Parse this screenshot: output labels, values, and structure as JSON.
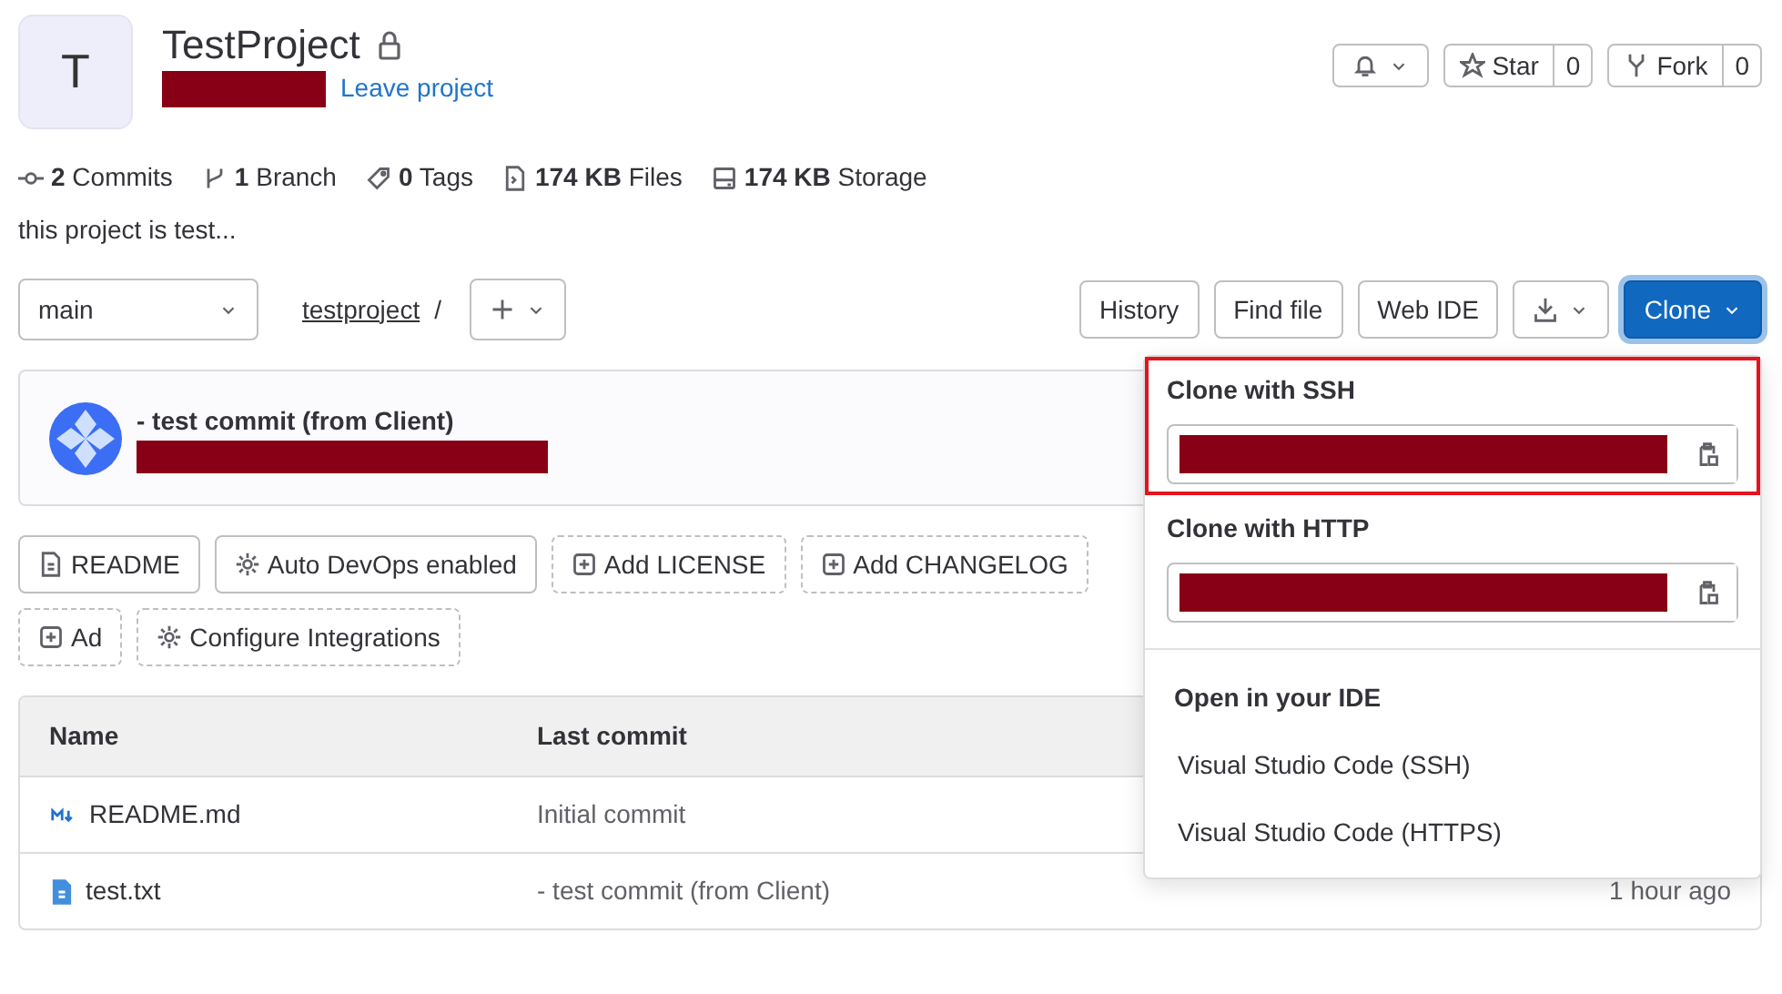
{
  "project": {
    "avatar_letter": "T",
    "name": "TestProject",
    "private": true,
    "leave_link": "Leave project"
  },
  "actions": {
    "star": {
      "label": "Star",
      "count": "0"
    },
    "fork": {
      "label": "Fork",
      "count": "0"
    }
  },
  "stats": [
    {
      "kind": "commits",
      "value": "2",
      "label": "Commits"
    },
    {
      "kind": "branch",
      "value": "1",
      "label": "Branch"
    },
    {
      "kind": "tags",
      "value": "0",
      "label": "Tags"
    },
    {
      "kind": "files",
      "value": "174 KB",
      "label": "Files"
    },
    {
      "kind": "storage",
      "value": "174 KB",
      "label": "Storage"
    }
  ],
  "description": "this project is test...",
  "branch": "main",
  "path": "testproject",
  "path_separator": "/",
  "toolbar_buttons": [
    "History",
    "Find file",
    "Web IDE"
  ],
  "clone_button": "Clone",
  "last_commit": {
    "title": "- test commit (from Client)"
  },
  "quick_buttons": [
    {
      "kind": "document",
      "label": "README"
    },
    {
      "kind": "setting",
      "label": "Auto DevOps enabled"
    },
    {
      "kind": "add",
      "label": "Add LICENSE"
    },
    {
      "kind": "add",
      "label": "Add CHANGELOG"
    },
    {
      "kind": "add",
      "label": "Ad"
    },
    {
      "kind": "setup",
      "label": "Configure Integrations"
    }
  ],
  "clone_menu": {
    "sections": [
      {
        "title": "Clone with SSH",
        "highlighted": true
      },
      {
        "title": "Clone with HTTP",
        "highlighted": false
      }
    ],
    "ide_title": "Open in your IDE",
    "ide_items": [
      "Visual Studio Code (SSH)",
      "Visual Studio Code (HTTPS)"
    ]
  },
  "table": {
    "columns": [
      "Name",
      "Last commit"
    ],
    "rows": [
      {
        "kind": "markdown",
        "name": "README.md",
        "commit": "Initial commit",
        "updated": ""
      },
      {
        "kind": "text",
        "name": "test.txt",
        "commit": "- test commit (from Client)",
        "updated": "1 hour ago"
      }
    ]
  }
}
